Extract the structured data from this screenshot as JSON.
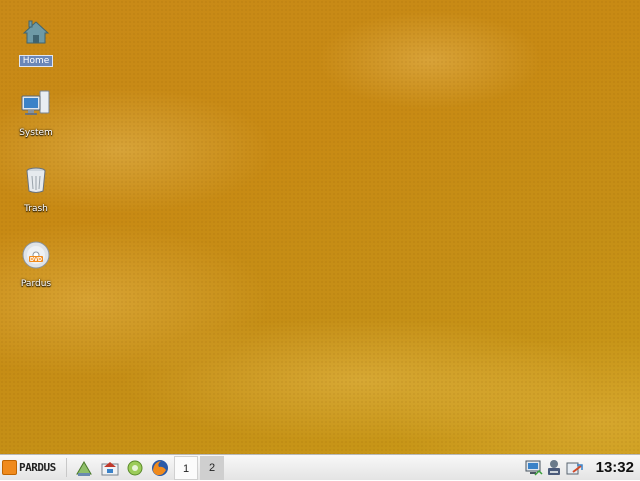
{
  "desktop": {
    "icons": [
      {
        "label": "Home",
        "icon": "home-icon",
        "selected": true
      },
      {
        "label": "System",
        "icon": "computer-icon",
        "selected": false
      },
      {
        "label": "Trash",
        "icon": "trash-icon",
        "selected": false
      },
      {
        "label": "Pardus",
        "icon": "dvd-icon",
        "selected": false
      }
    ],
    "background_color": "#c88a14"
  },
  "taskbar": {
    "start_label": "PARDUS",
    "start_icon": "pardus-logo-icon",
    "launchers": [
      {
        "icon": "network-share-icon"
      },
      {
        "icon": "home-folder-icon"
      },
      {
        "icon": "settings-gear-icon"
      },
      {
        "icon": "firefox-icon"
      }
    ],
    "pager": {
      "desktops": [
        "1",
        "2"
      ],
      "active": "1"
    },
    "tray": [
      {
        "icon": "network-monitor-icon"
      },
      {
        "icon": "printer-icon"
      },
      {
        "icon": "clipboard-icon"
      }
    ],
    "clock": "13:32"
  }
}
